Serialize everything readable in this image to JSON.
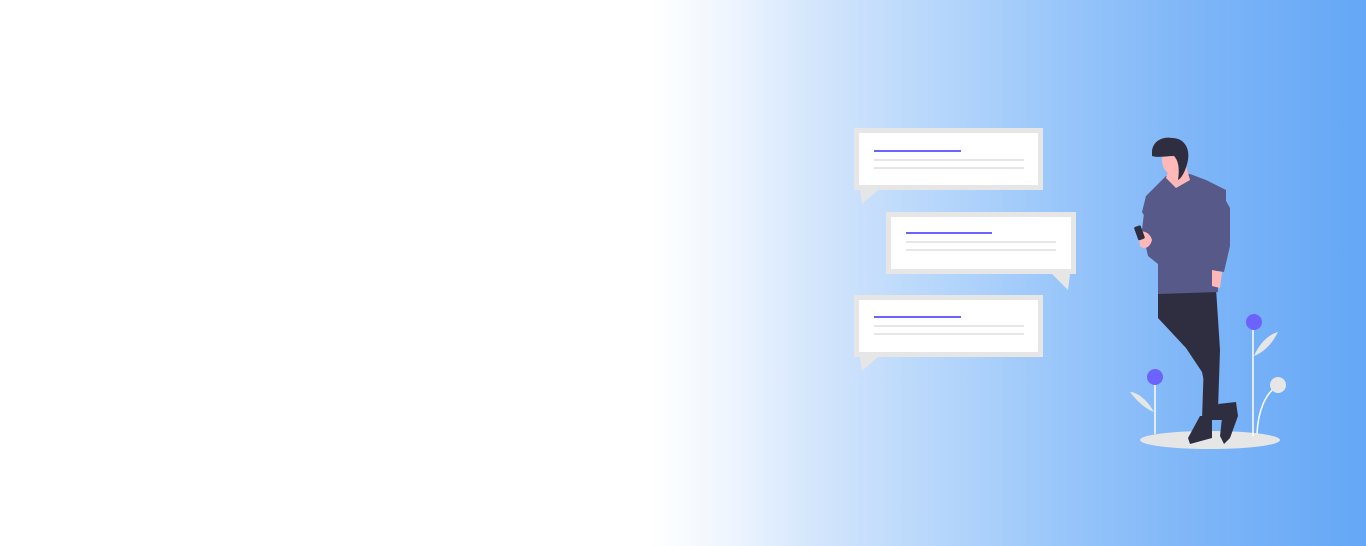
{
  "banner": {
    "background": {
      "gradient_start": "#ffffff",
      "gradient_end": "#64a7f6"
    },
    "illustration": {
      "subject": "person-reading-chat-messages",
      "chat_bubbles": [
        {
          "name": "chat-bubble-1",
          "tail": "bottom-left"
        },
        {
          "name": "chat-bubble-2",
          "tail": "bottom-right"
        },
        {
          "name": "chat-bubble-3",
          "tail": "bottom-left"
        }
      ],
      "colors": {
        "accent_line": "#6c63ff",
        "text_line": "#e6e6e6",
        "bubble_border": "#e6e6e6",
        "bubble_fill": "#ffffff",
        "shirt": "#575a89",
        "pants": "#2f2e41",
        "skin": "#ffb8b8",
        "hair": "#2f2e41",
        "flower": "#6c63ff",
        "ground": "#e6e6e6"
      }
    }
  }
}
